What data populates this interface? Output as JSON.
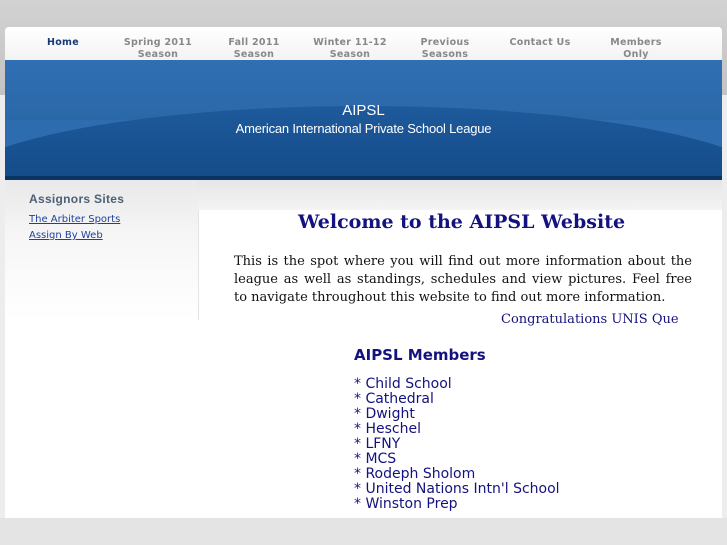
{
  "nav": {
    "items": [
      {
        "label": "Home",
        "active": true
      },
      {
        "label": "Spring 2011\nSeason",
        "active": false
      },
      {
        "label": "Fall 2011\nSeason",
        "active": false
      },
      {
        "label": "Winter 11-12\nSeason",
        "active": false
      },
      {
        "label": "Previous\nSeasons",
        "active": false
      },
      {
        "label": "Contact Us",
        "active": false
      },
      {
        "label": "Members\nOnly",
        "active": false
      }
    ]
  },
  "banner": {
    "title": "AIPSL",
    "subtitle": "American International Private School League"
  },
  "sidebar": {
    "title": "Assignors Sites",
    "links": [
      "The Arbiter Sports",
      "Assign By Web"
    ]
  },
  "main": {
    "welcome": "Welcome to the AIPSL Website",
    "intro": "This is the spot where you will find out more information about the league as well as standings, schedules and view pictures. Feel free to navigate throughout this website to find out more information.",
    "marquee": "Congratulations UNIS Que",
    "members_title": "AIPSL Members",
    "members": [
      "* Child School",
      "* Cathedral",
      "* Dwight",
      "* Heschel",
      "* LFNY",
      "* MCS",
      "* Rodeph Sholom",
      "* United Nations Intn'l School",
      "* Winston Prep"
    ]
  },
  "colors": {
    "nav_active": "#163a78",
    "nav_inactive": "#888888",
    "banner_blue": "#2d6daf",
    "heading_navy": "#14127e",
    "link_blue": "#1e3fa0"
  }
}
